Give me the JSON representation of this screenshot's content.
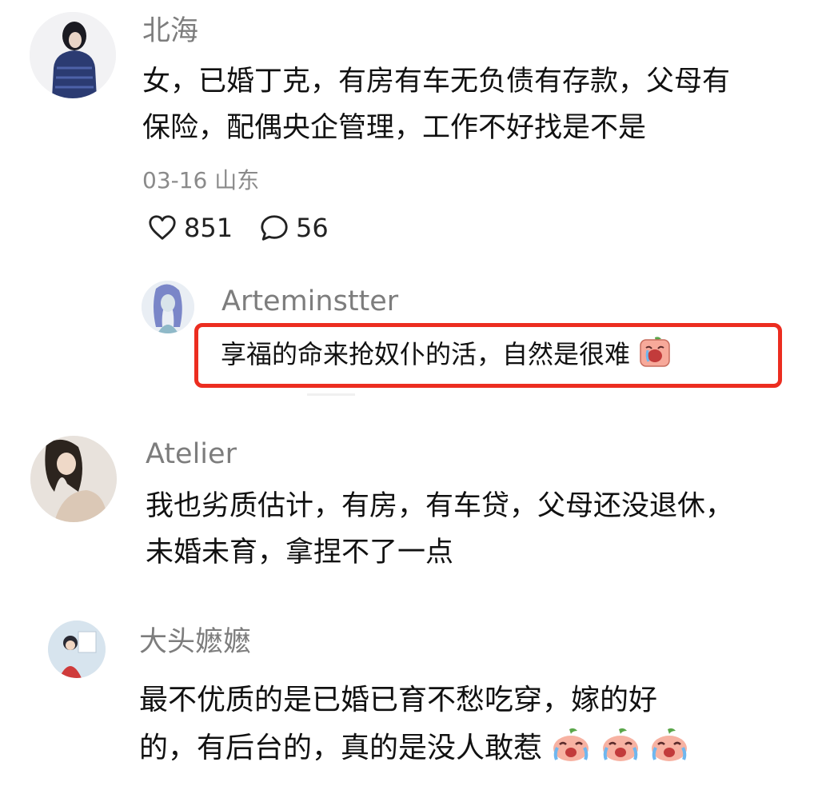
{
  "comments": [
    {
      "username": "北海",
      "line1": "女，已婚丁克，有房有车无负债有存款，父母有",
      "line2": "保险，配偶央企管理，工作不好找是不是",
      "date": "03-16",
      "location": "山东",
      "likes": "851",
      "replies": "56"
    },
    {
      "username": "Atelier",
      "line1": "我也劣质估计，有房，有车贷，父母还没退休，",
      "line2": "未婚未育，拿捏不了一点"
    },
    {
      "username": "大头嬷嬷",
      "line1": "最不优质的是已婚已育不愁吃穿，嫁的好",
      "line2": "的，有后台的，真的是没人敢惹"
    }
  ],
  "reply": {
    "username": "Arteminstter",
    "text": "享福的命来抢奴仆的活，自然是很难"
  },
  "colors": {
    "highlight_border": "#ec2d20",
    "username": "#7d7d7d",
    "meta": "#8a8a8a"
  },
  "icons": {
    "like": "heart-outline-icon",
    "comment": "speech-bubble-icon",
    "reply_emoji": "crying-peach-emoji",
    "trailing_emoji": "crying-peach-emoji"
  }
}
